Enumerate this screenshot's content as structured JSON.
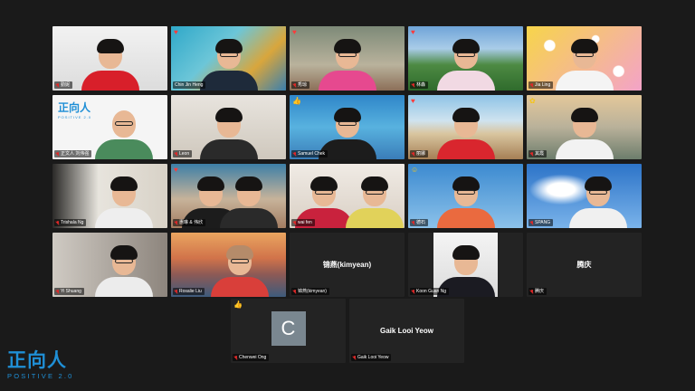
{
  "participants": [
    {
      "name": "勤妮",
      "reaction": "",
      "mic_muted": true
    },
    {
      "name": "Chin Jin Heng",
      "reaction": "heart",
      "mic_muted": false,
      "speaking": true
    },
    {
      "name": "秀琼",
      "reaction": "heart",
      "mic_muted": true
    },
    {
      "name": "林森",
      "reaction": "heart",
      "mic_muted": true
    },
    {
      "name": "Jia Ling",
      "reaction": "",
      "mic_muted": true
    },
    {
      "name": "正文人 刘伟强",
      "reaction": "",
      "mic_muted": true,
      "tile_text": "正向人",
      "tile_subtext": "POSITIVE 2.0"
    },
    {
      "name": "Leon",
      "reaction": "",
      "mic_muted": true
    },
    {
      "name": "Samuel Chek",
      "reaction": "thumb",
      "mic_muted": true
    },
    {
      "name": "丽娜",
      "reaction": "heart",
      "mic_muted": true
    },
    {
      "name": "其霞",
      "reaction": "flower",
      "mic_muted": true
    },
    {
      "name": "Trishala Ng",
      "reaction": "",
      "mic_muted": true
    },
    {
      "name": "惠琳 & 伟欣",
      "reaction": "heart",
      "mic_muted": true
    },
    {
      "name": "wai fen",
      "reaction": "",
      "mic_muted": true
    },
    {
      "name": "德石",
      "reaction": "smile",
      "mic_muted": true
    },
    {
      "name": "SPANG",
      "reaction": "",
      "mic_muted": true
    },
    {
      "name": "Yi Shuang",
      "reaction": "",
      "mic_muted": true
    },
    {
      "name": "Rosalie Liu",
      "reaction": "",
      "mic_muted": true
    },
    {
      "name": "锦燕(kimyean)",
      "reaction": "",
      "mic_muted": true,
      "video_off": true,
      "display_name": "锦燕(kimyean)"
    },
    {
      "name": "Koon Guan Ng",
      "reaction": "",
      "mic_muted": true
    },
    {
      "name": "腾庆",
      "reaction": "",
      "mic_muted": true,
      "video_off": true,
      "display_name": "腾庆"
    },
    {
      "name": "Chenwei Ong",
      "reaction": "thumb",
      "mic_muted": true,
      "video_off": true,
      "avatar_letter": "C"
    },
    {
      "name": "Gaik Looi Yeow",
      "reaction": "",
      "mic_muted": true,
      "video_off": true,
      "display_name": "Gaik Looi Yeow"
    }
  ],
  "reaction_glyphs": {
    "heart": "♥",
    "thumb": "👍",
    "flower": "✿",
    "smile": "☺"
  },
  "colors": {
    "speaking_border": "#c8d600",
    "muted_mic": "#e02828",
    "brand_blue": "#1f8fd6"
  },
  "logo": {
    "main": "正向人",
    "sub": "POSITIVE 2.0"
  }
}
